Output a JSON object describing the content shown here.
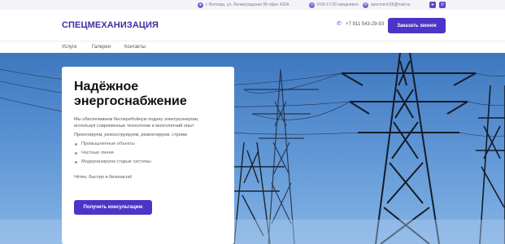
{
  "topbar": {
    "address": "г. Вологда, ул. Ленинградская 98 офис 426А",
    "hours": "8:00-17:00 ежедневно",
    "email": "specmech35@mail.ru"
  },
  "header": {
    "logo": "СПЕЦМЕХАНИЗАЦИЯ",
    "phone": "+7 911 543-29-93",
    "call_button": "Заказать звонок"
  },
  "nav": {
    "items": [
      {
        "label": "Услуги"
      },
      {
        "label": "Галерея"
      },
      {
        "label": "Контакты"
      }
    ]
  },
  "hero": {
    "title": "Надёжное энергоснабжение",
    "description": "Мы обеспечиваем бесперебойную подачу электроэнергии, используя современные технологии и многолетний опыт",
    "subtitle": "Проектируем, реконструируем, ремонтируем, строим",
    "list": [
      "Промышленные объекты",
      "Частные линии",
      "Модернизируем старые системы"
    ],
    "tagline": "Чётко, быстро и безопасно!",
    "cta": "Получить консультацию"
  },
  "icons": {
    "location": "location-icon",
    "clock": "clock-icon",
    "mail": "mail-icon",
    "telegram": "telegram-icon",
    "whatsapp": "whatsapp-icon",
    "phone": "phone-icon"
  },
  "colors": {
    "brand": "#3a2fa3",
    "button": "#4a35c6",
    "sky": "#5a92d3"
  }
}
